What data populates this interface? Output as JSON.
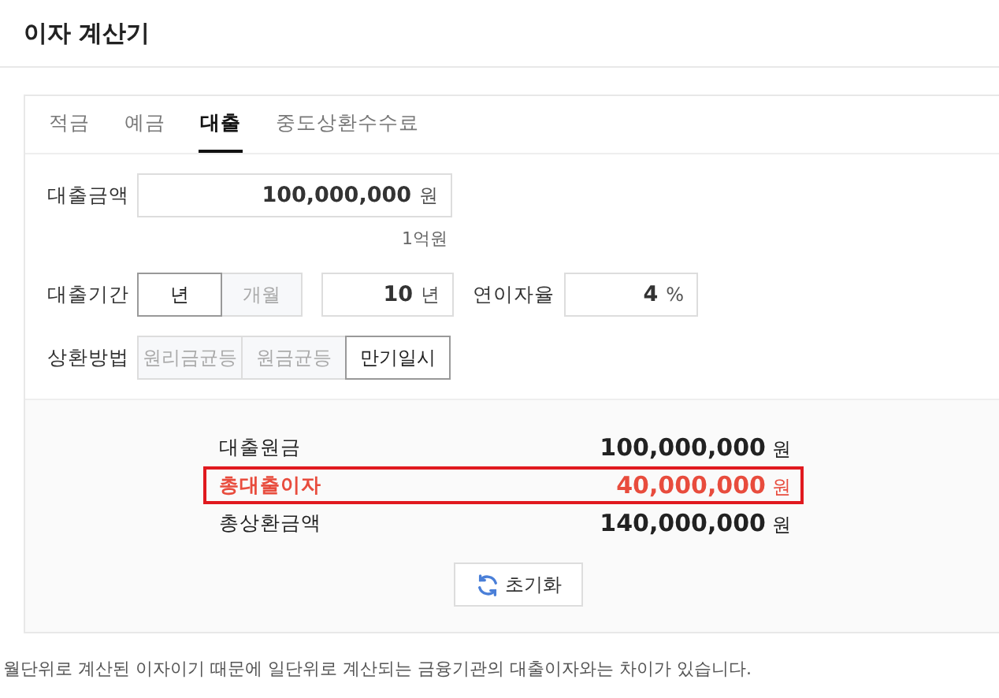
{
  "window": {
    "title": "이자 계산기"
  },
  "tabs": [
    {
      "label": "적금",
      "selected": false
    },
    {
      "label": "예금",
      "selected": false
    },
    {
      "label": "대출",
      "selected": true
    },
    {
      "label": "중도상환수수료",
      "selected": false
    }
  ],
  "form": {
    "amount": {
      "label": "대출금액",
      "value": "100,000,000",
      "unit": "원",
      "hint": "1억원"
    },
    "period": {
      "label": "대출기간",
      "units": [
        {
          "label": "년",
          "selected": true
        },
        {
          "label": "개월",
          "selected": false
        }
      ],
      "value": "10",
      "unit": "년"
    },
    "rate": {
      "label": "연이자율",
      "value": "4",
      "unit": "%"
    },
    "repayment": {
      "label": "상환방법",
      "options": [
        {
          "label": "원리금균등",
          "selected": false
        },
        {
          "label": "원금균등",
          "selected": false
        },
        {
          "label": "만기일시",
          "selected": true
        }
      ]
    }
  },
  "results": [
    {
      "label": "대출원금",
      "value": "100,000,000",
      "unit": "원",
      "highlighted": false
    },
    {
      "label": "총대출이자",
      "value": "40,000,000",
      "unit": "원",
      "highlighted": true
    },
    {
      "label": "총상환금액",
      "value": "140,000,000",
      "unit": "원",
      "highlighted": false
    }
  ],
  "reset_button": {
    "label": "초기화"
  },
  "footnote": "월단위로 계산된 이자이기 때문에 일단위로 계산되는 금융기관의 대출이자와는 차이가 있습니다."
}
